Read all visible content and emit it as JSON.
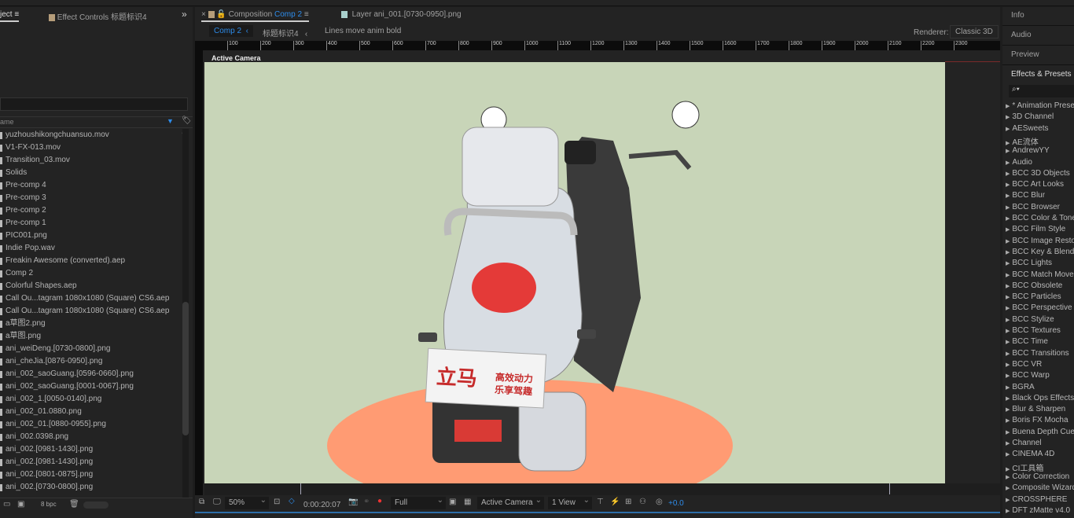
{
  "left_panel": {
    "project_tab": "ject",
    "effect_controls_tab": "Effect Controls 标题标识4",
    "name_header": "ame",
    "bpc": "8 bpc",
    "items": [
      "yuzhoushikongchuansuo.mov",
      "V1-FX-013.mov",
      "Transition_03.mov",
      "Solids",
      "Pre-comp 4",
      "Pre-comp 3",
      "Pre-comp 2",
      "Pre-comp 1",
      "PIC001.png",
      "Indie Pop.wav",
      "Freakin Awesome (converted).aep",
      "Comp 2",
      "Colorful Shapes.aep",
      "Call Ou...tagram 1080x1080 (Square) CS6.aep",
      "Call Ou...tagram 1080x1080 (Square) CS6.aep",
      "a草图2.png",
      "a草图.png",
      "ani_weiDeng.[0730-0800].png",
      "ani_cheJia.[0876-0950].png",
      "ani_002_saoGuang.[0596-0660].png",
      "ani_002_saoGuang.[0001-0067].png",
      "ani_002_1.[0050-0140].png",
      "ani_002_01.0880.png",
      "ani_002_01.[0880-0955].png",
      "ani_002.0398.png",
      "ani_002.[0981-1430].png",
      "ani_002.[0981-1430].png",
      "ani_002.[0801-0875].png",
      "ani_002.[0730-0800].png"
    ]
  },
  "comp_panel": {
    "composition_tab_prefix": "Composition",
    "composition_tab_name": "Comp 2",
    "layer_tab": "Layer ani_001.[0730-0950].png",
    "breadcrumbs": [
      "Comp 2",
      "标题标识4",
      "Lines move anim bold"
    ],
    "renderer_label": "Renderer:",
    "renderer_value": "Classic 3D",
    "ruler_ticks": [
      "100",
      "200",
      "300",
      "400",
      "500",
      "600",
      "700",
      "800",
      "900",
      "1000",
      "1100",
      "1200",
      "1300",
      "1400",
      "1500",
      "1600",
      "1700",
      "1800",
      "1900",
      "2000",
      "2100",
      "2200",
      "2300"
    ],
    "viewer_label": "Active Camera",
    "plate_brand": "立马",
    "plate_line1": "高效动力",
    "plate_line2": "乐享驾趣",
    "zoom": "50%",
    "timecode": "0:00:20:07",
    "resolution": "Full",
    "camera": "Active Camera",
    "views": "1 View",
    "exposure": "+0.0",
    "colors": {
      "background": "#c8d5b8",
      "floor": "#ff9b73",
      "accent": "#2d8ceb"
    }
  },
  "right_panel": {
    "tabs": [
      "Info",
      "Audio",
      "Preview",
      "Effects & Presets"
    ],
    "effects": [
      "* Animation Presets",
      "3D Channel",
      "AESweets",
      "AE流体",
      "AndrewYY",
      "Audio",
      "BCC 3D Objects",
      "BCC Art Looks",
      "BCC Blur",
      "BCC Browser",
      "BCC Color & Tone",
      "BCC Film Style",
      "BCC Image Restoration",
      "BCC Key & Blend",
      "BCC Lights",
      "BCC Match Move",
      "BCC Obsolete",
      "BCC Particles",
      "BCC Perspective",
      "BCC Stylize",
      "BCC Textures",
      "BCC Time",
      "BCC Transitions",
      "BCC VR",
      "BCC Warp",
      "BGRA",
      "Black Ops Effects",
      "Blur & Sharpen",
      "Boris FX Mocha",
      "Buena Depth Cue",
      "Channel",
      "CINEMA 4D",
      "CI工具箱",
      "Color Correction",
      "Composite Wizard",
      "CROSSPHERE",
      "DFT zMatte v4.0"
    ]
  }
}
